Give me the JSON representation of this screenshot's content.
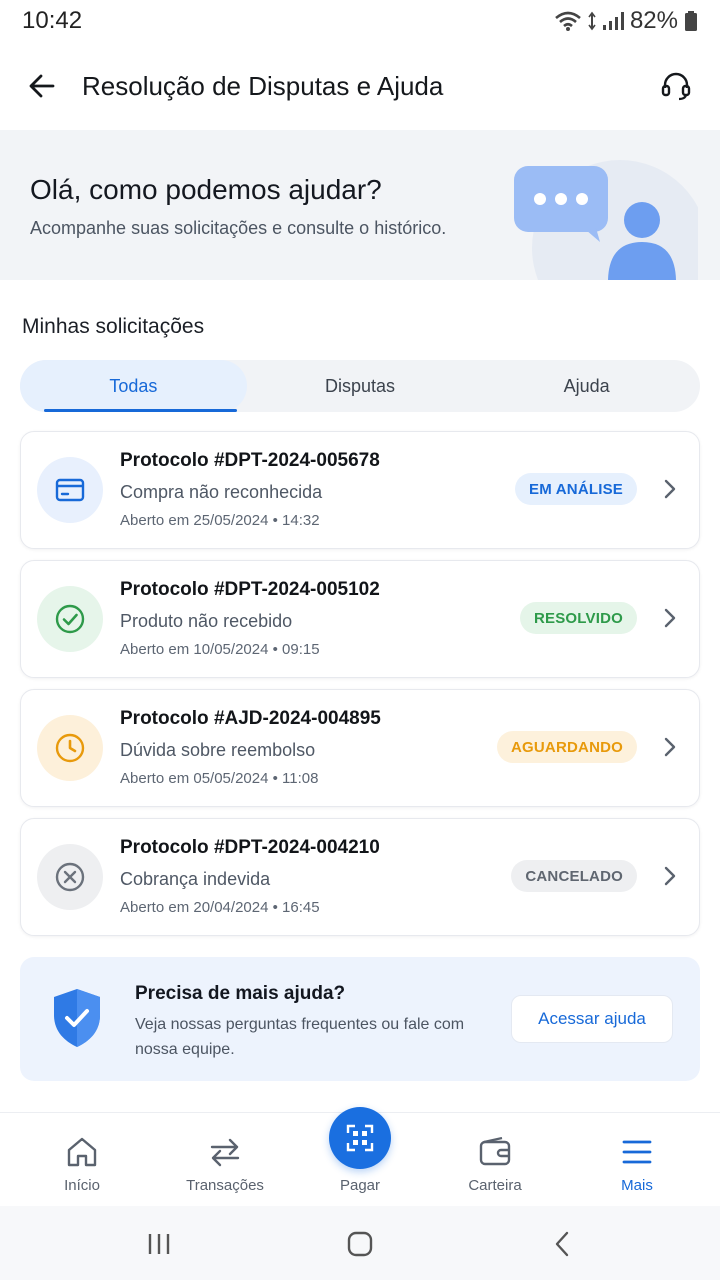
{
  "status_bar": {
    "time": "10:42",
    "battery": "82%"
  },
  "app_bar": {
    "title": "Resolução de Disputas e Ajuda"
  },
  "hero": {
    "title": "Olá, como podemos ajudar?",
    "subtitle": "Acompanhe suas solicitações e consulte o histórico."
  },
  "section": {
    "title": "Minhas solicitações"
  },
  "tabs": [
    {
      "label": "Todas",
      "active": true
    },
    {
      "label": "Disputas",
      "active": false
    },
    {
      "label": "Ajuda",
      "active": false
    }
  ],
  "requests": [
    {
      "title": "Protocolo #DPT-2024-005678",
      "subtitle": "Compra não reconhecida",
      "date": "Aberto em 25/05/2024 • 14:32",
      "status": "EM ANÁLISE",
      "icon": "credit-card-icon",
      "status_color": "#1769d8",
      "status_bg": "#e6f0fd",
      "icon_bg": "#e8f0fd"
    },
    {
      "title": "Protocolo #DPT-2024-005102",
      "subtitle": "Produto não recebido",
      "date": "Aberto em 10/05/2024 • 09:15",
      "status": "RESOLVIDO",
      "icon": "check-circle-icon",
      "status_color": "#2e9a4a",
      "status_bg": "#e5f5e9",
      "icon_bg": "#e6f5ea"
    },
    {
      "title": "Protocolo #AJD-2024-004895",
      "subtitle": "Dúvida sobre reembolso",
      "date": "Aberto em 05/05/2024 • 11:08",
      "status": "AGUARDANDO",
      "icon": "clock-icon",
      "status_color": "#e89a0c",
      "status_bg": "#fdf1dc",
      "icon_bg": "#fdf0da"
    },
    {
      "title": "Protocolo #DPT-2024-004210",
      "subtitle": "Cobrança indevida",
      "date": "Aberto em 20/04/2024 • 16:45",
      "status": "CANCELADO",
      "icon": "x-circle-icon",
      "status_color": "#5f6670",
      "status_bg": "#eeeff1",
      "icon_bg": "#eeeff1"
    }
  ],
  "help": {
    "title": "Precisa de mais ajuda?",
    "text": "Veja nossas perguntas frequentes ou fale com nossa equipe.",
    "button": "Acessar ajuda"
  },
  "bottom_nav": [
    {
      "label": "Início",
      "icon": "home-icon"
    },
    {
      "label": "Transações",
      "icon": "transfer-arrows-icon"
    },
    {
      "label": "Pagar",
      "icon": "qr-code-icon"
    },
    {
      "label": "Carteira",
      "icon": "wallet-icon"
    },
    {
      "label": "Mais",
      "icon": "menu-icon",
      "active": true
    }
  ],
  "colors": {
    "primary": "#1769d8",
    "surface": "#f2f4f7"
  }
}
